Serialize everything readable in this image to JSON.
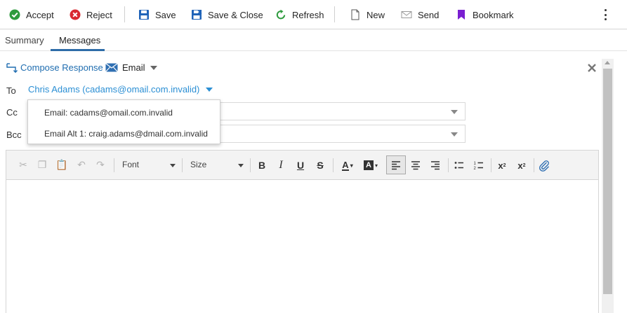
{
  "toolbar": {
    "accept": "Accept",
    "reject": "Reject",
    "save": "Save",
    "save_close": "Save & Close",
    "refresh": "Refresh",
    "new": "New",
    "send": "Send",
    "bookmark": "Bookmark"
  },
  "tabs": {
    "summary": "Summary",
    "messages": "Messages",
    "active": "Messages"
  },
  "compose": {
    "compose_response": "Compose Response",
    "email_type": "Email"
  },
  "fields": {
    "to_label": "To",
    "to_value": "Chris Adams (cadams@omail.com.invalid)",
    "cc_label": "Cc",
    "bcc_label": "Bcc"
  },
  "dropdown": {
    "items": [
      "Email: cadams@omail.com.invalid",
      "Email Alt 1: craig.adams@dmail.com.invalid"
    ]
  },
  "editor": {
    "font_label": "Font",
    "size_label": "Size",
    "active_alignment": "align-left"
  },
  "colors": {
    "accept_green": "#2e9b3e",
    "reject_red": "#d9282f",
    "save_blue": "#1f63b8",
    "bookmark_purple": "#7a1fd1",
    "link_blue": "#1f6db0",
    "to_blue": "#2b8fd4",
    "tab_underline": "#2d6ca8"
  }
}
